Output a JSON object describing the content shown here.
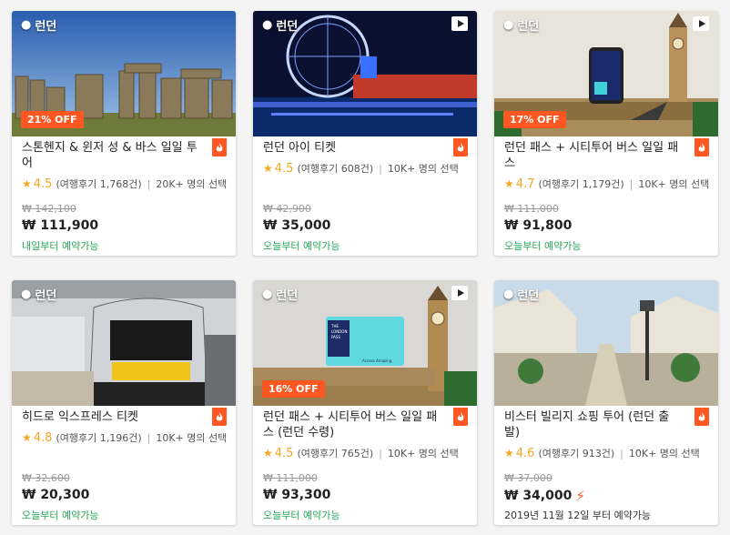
{
  "cards": [
    {
      "location": "런던",
      "discount": "21% OFF",
      "title": "스톤헨지 & 윈저 성 & 바스 일일 투어",
      "score": "4.5",
      "reviews": "(여행후기 1,768건)",
      "chosen": "20K+ 명의 선택",
      "orig_price": "₩ 142,100",
      "price": "₩ 111,900",
      "availability": "내일부터 예약가능"
    },
    {
      "location": "런던",
      "discount": "",
      "title": "런던 아이 티켓",
      "score": "4.5",
      "reviews": "(여행후기 608건)",
      "chosen": "10K+ 명의 선택",
      "orig_price": "₩ 42,900",
      "price": "₩ 35,000",
      "availability": "오늘부터 예약가능"
    },
    {
      "location": "런던",
      "discount": "17% OFF",
      "title": "런던 패스 + 시티투어 버스 일일 패스",
      "score": "4.7",
      "reviews": "(여행후기 1,179건)",
      "chosen": "10K+ 명의 선택",
      "orig_price": "₩ 111,000",
      "price": "₩ 91,800",
      "availability": "오늘부터 예약가능"
    },
    {
      "location": "런던",
      "discount": "",
      "title": "히드로 익스프레스 티켓",
      "score": "4.8",
      "reviews": "(여행후기 1,196건)",
      "chosen": "10K+ 명의 선택",
      "orig_price": "₩ 32,600",
      "price": "₩ 20,300",
      "availability": "오늘부터 예약가능"
    },
    {
      "location": "런던",
      "discount": "16% OFF",
      "title": "런던 패스 + 시티투어 버스 일일 패스 (런던 수령)",
      "score": "4.5",
      "reviews": "(여행후기 765건)",
      "chosen": "10K+ 명의 선택",
      "orig_price": "₩ 111,000",
      "price": "₩ 93,300",
      "availability": "오늘부터 예약가능"
    },
    {
      "location": "런던",
      "discount": "",
      "title": "비스터 빌리지 쇼핑 투어 (런던 출발)",
      "score": "4.6",
      "reviews": "(여행후기 913건)",
      "chosen": "10K+ 명의 선택",
      "orig_price": "₩ 37,000",
      "price": "₩ 34,000",
      "availability": "2019년 11월 12일 부터 예약가능"
    }
  ],
  "pass_card_text": [
    "THE",
    "LONDON",
    "PASS",
    "Access Amazing"
  ],
  "colors": {
    "accent": "#ff5722",
    "star": "#f5a623",
    "available": "#27a85a"
  },
  "icons": {
    "location": "map-pin-icon",
    "video": "play-icon",
    "badge": "klook-flame-icon",
    "instant": "lightning-icon"
  }
}
